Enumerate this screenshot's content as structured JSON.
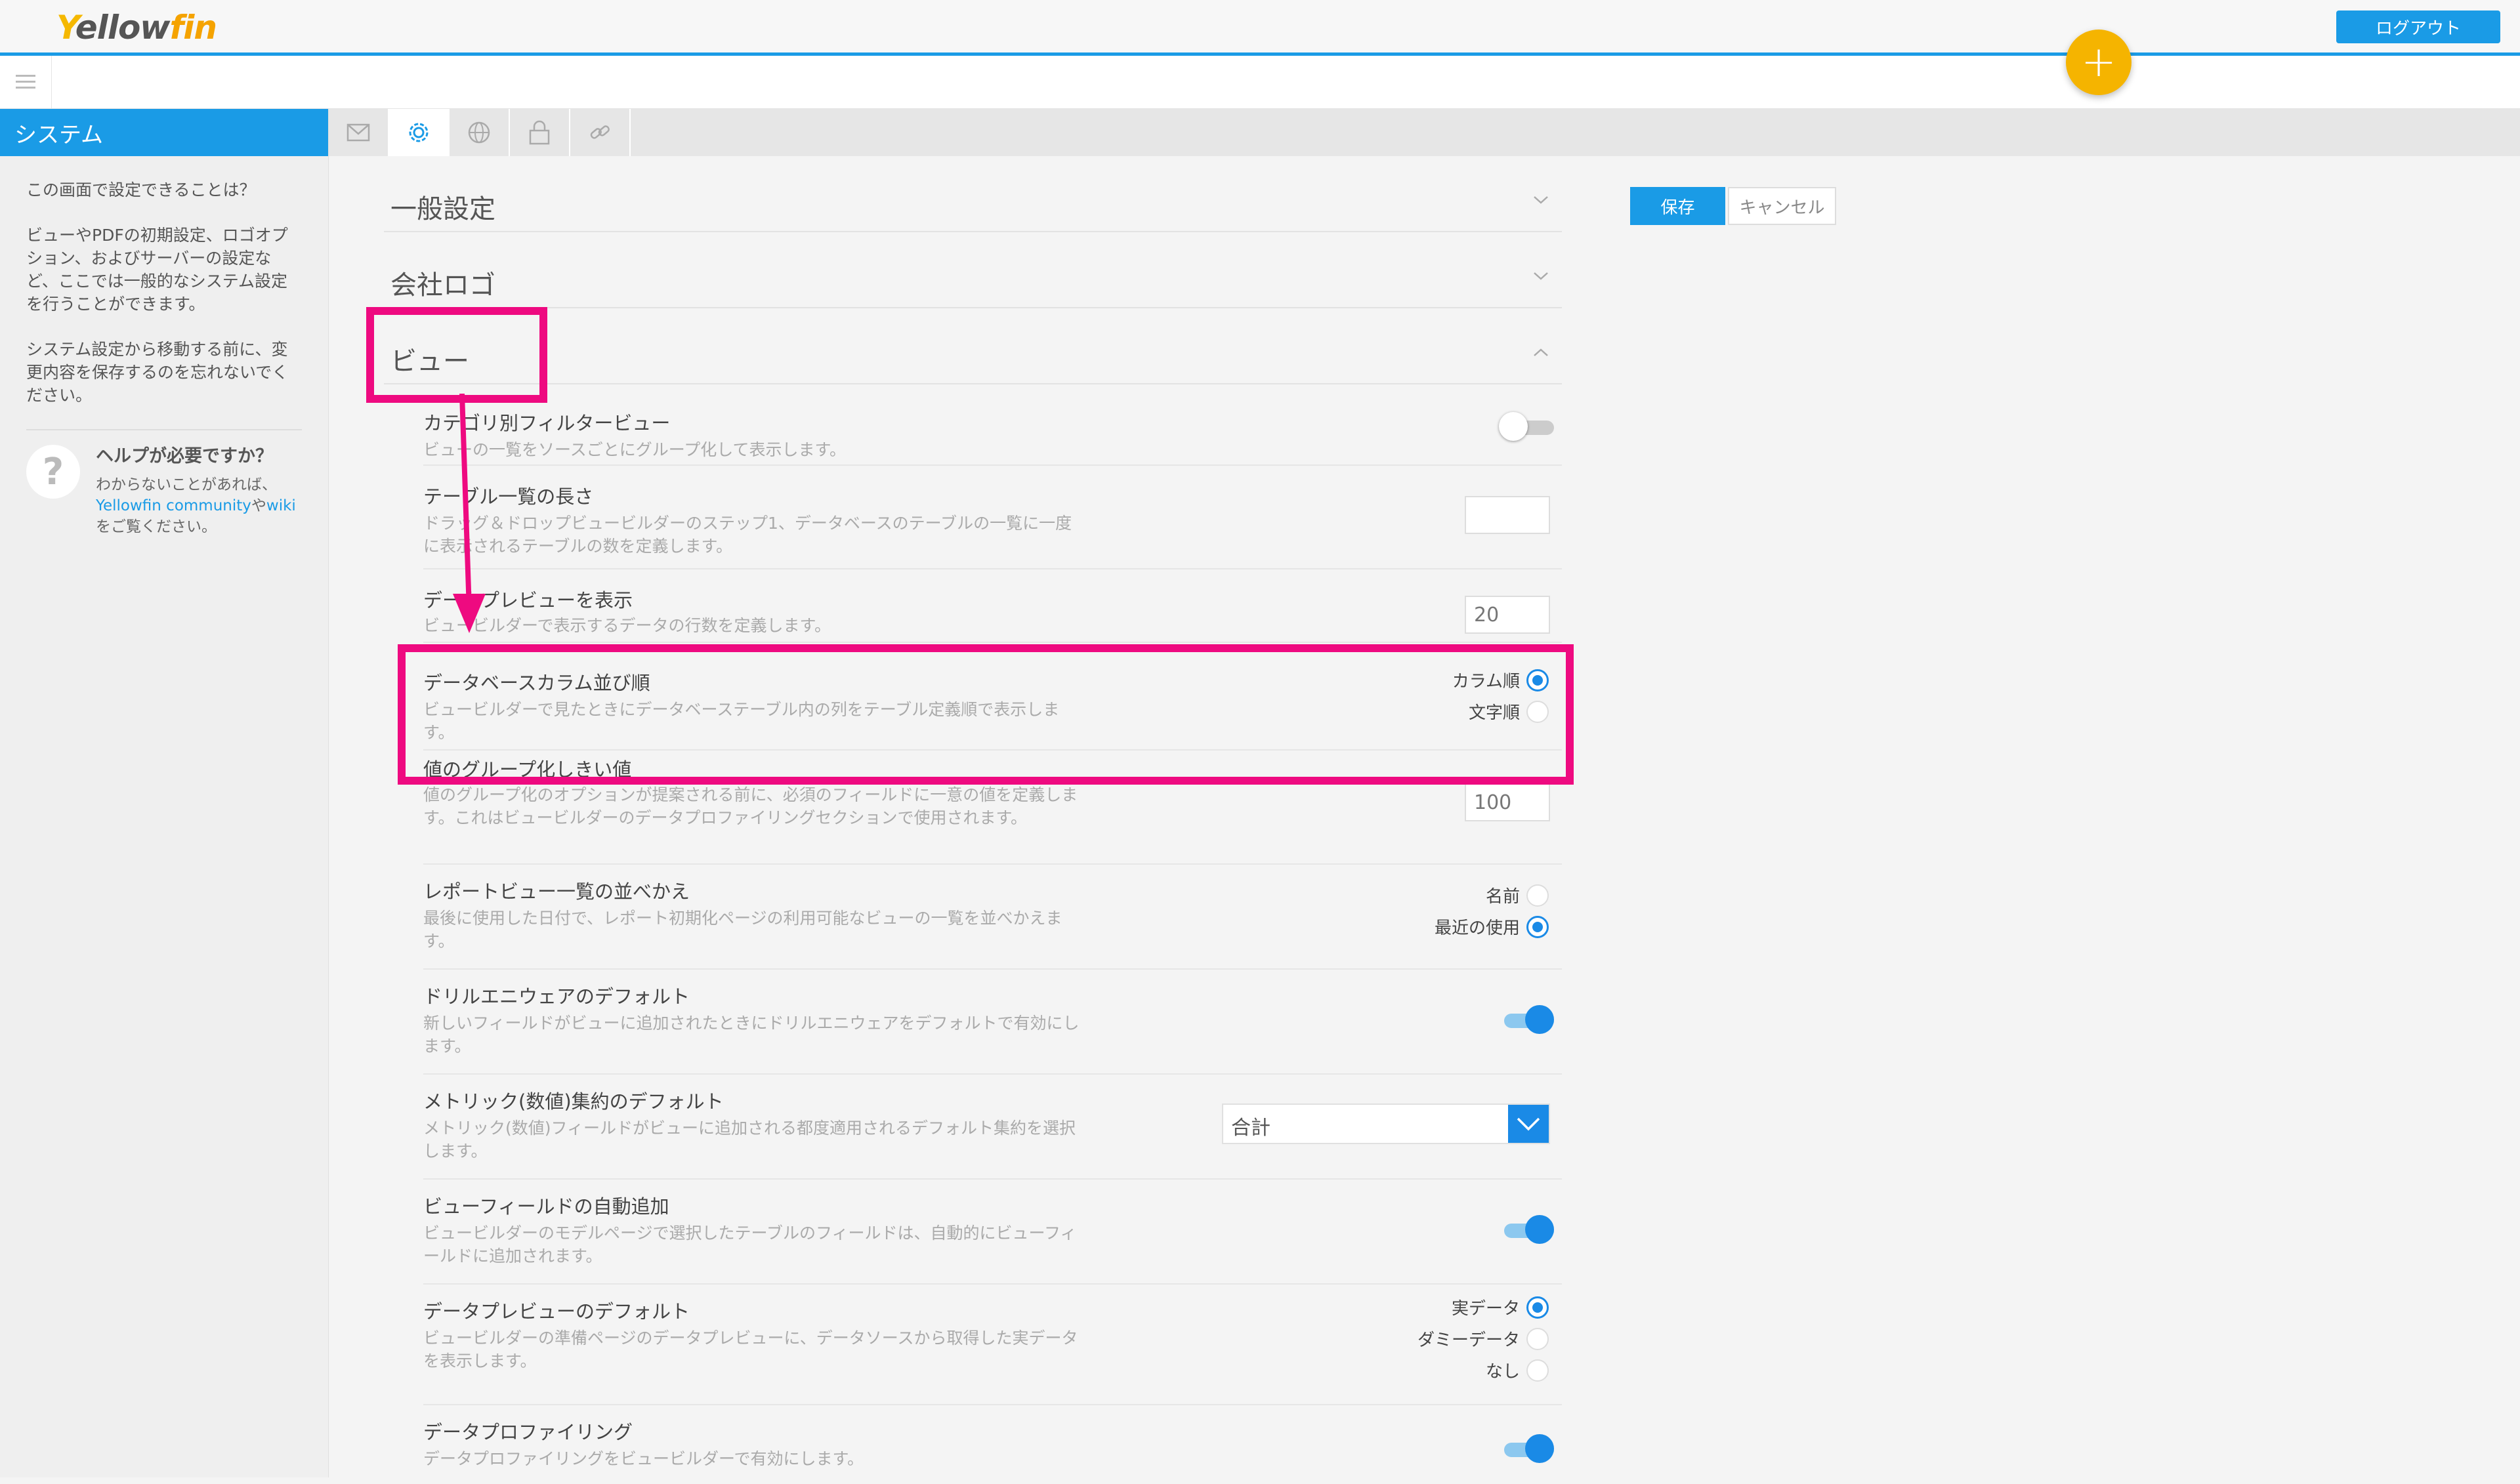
{
  "header": {
    "logo_y": "Y",
    "logo_ellow": "ellow",
    "logo_fin": "fin",
    "logout_label": "ログアウト",
    "fab_label": "+"
  },
  "sidebar": {
    "title": "システム",
    "intro_question": "この画面で設定できることは？",
    "intro_text": "ビューやPDFの初期設定、ロゴオプション、およびサーバーの設定など、ここでは一般的なシステム設定を行うことができます。",
    "reminder_text": "システム設定から移動する前に、変更内容を保存するのを忘れないでください。",
    "help_title": "ヘルプが必要ですか？",
    "help_text_1": "わからないことがあれば、",
    "help_link_community": "Yellowfin community",
    "help_text_2": "や",
    "help_link_wiki": "wiki",
    "help_text_3": "をご覧ください。"
  },
  "tabs": [
    "mail-icon",
    "gear-icon",
    "globe-icon",
    "lock-icon",
    "link-icon"
  ],
  "actions": {
    "save": "保存",
    "cancel": "キャンセル"
  },
  "sections": {
    "general": "一般設定",
    "logo": "会社ロゴ",
    "view": "ビュー"
  },
  "settings": {
    "category_filter": {
      "label": "カテゴリ別フィルタービュー",
      "desc": "ビューの一覧をソースごとにグループ化して表示します。",
      "enabled": false
    },
    "table_list_length": {
      "label": "テーブル一覧の長さ",
      "desc": "ドラッグ＆ドロップビュービルダーのステップ1、データベースのテーブルの一覧に一度に表示されるテーブルの数を定義します。",
      "value": ""
    },
    "data_preview": {
      "label": "データプレビューを表示",
      "desc": "ビュービルダーで表示するデータの行数を定義します。",
      "value": "20"
    },
    "column_order": {
      "label": "データベースカラム並び順",
      "desc": "ビュービルダーで見たときにデータベーステーブル内の列をテーブル定義順で表示します。",
      "option_column": "カラム順",
      "option_alpha": "文字順",
      "selected": "カラム順"
    },
    "grouping_threshold": {
      "label": "値のグループ化しきい値",
      "desc": "値のグループ化のオプションが提案される前に、必須のフィールドに一意の値を定義します。これはビュービルダーのデータプロファイリングセクションで使用されます。",
      "value": "100"
    },
    "report_view_sort": {
      "label": "レポートビュー一覧の並べかえ",
      "desc": "最後に使用した日付で、レポート初期化ページの利用可能なビューの一覧を並べかえます。",
      "option_name": "名前",
      "option_recent": "最近の使用",
      "selected": "最近の使用"
    },
    "drill_anywhere": {
      "label": "ドリルエニウェアのデフォルト",
      "desc": "新しいフィールドがビューに追加されたときにドリルエニウェアをデフォルトで有効にします。",
      "enabled": true
    },
    "metric_aggregation": {
      "label": "メトリック(数値)集約のデフォルト",
      "desc": "メトリック(数値)フィールドがビューに追加される都度適用されるデフォルト集約を選択します。",
      "value": "合計"
    },
    "auto_add_fields": {
      "label": "ビューフィールドの自動追加",
      "desc": "ビュービルダーのモデルページで選択したテーブルのフィールドは、自動的にビューフィールドに追加されます。",
      "enabled": true
    },
    "data_preview_default": {
      "label": "データプレビューのデフォルト",
      "desc": "ビュービルダーの準備ページのデータプレビューに、データソースから取得した実データを表示します。",
      "option_real": "実データ",
      "option_dummy": "ダミーデータ",
      "option_none": "なし",
      "selected": "実データ"
    },
    "data_profiling": {
      "label": "データプロファイリング",
      "desc": "データプロファイリングをビュービルダーで有効にします。",
      "enabled": true
    }
  },
  "colors": {
    "accent": "#1a9be6",
    "highlight": "#ee0a80",
    "fab": "#f5b400"
  }
}
